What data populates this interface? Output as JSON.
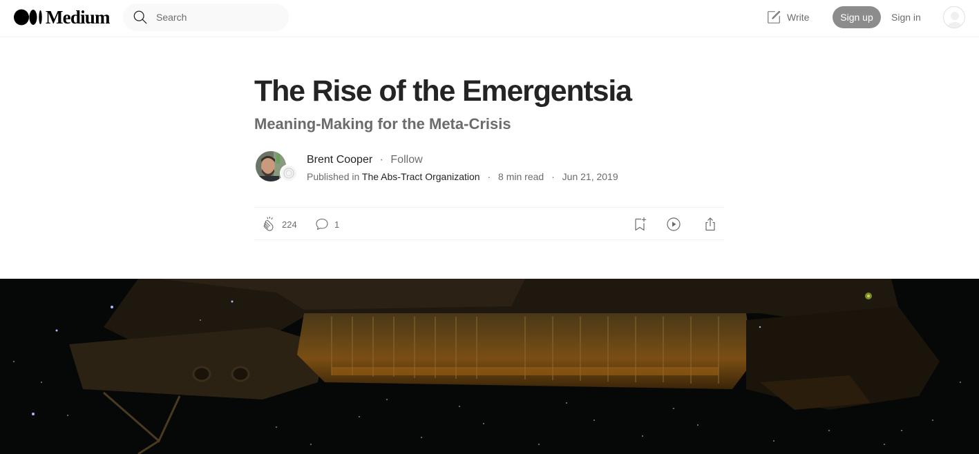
{
  "header": {
    "brand": "Medium",
    "search_placeholder": "Search",
    "write_label": "Write",
    "signup_label": "Sign up",
    "signin_label": "Sign in"
  },
  "article": {
    "title": "The Rise of the Emergentsia",
    "subtitle": "Meaning-Making for the Meta-Crisis",
    "author": "Brent Cooper",
    "follow_label": "Follow",
    "published_in_label": "Published in",
    "publication": "The Abs-Tract Organization",
    "read_time": "8 min read",
    "date": "Jun 21, 2019"
  },
  "actions": {
    "claps": "224",
    "comments": "1"
  },
  "icons": [
    "search-icon",
    "write-icon",
    "clap-icon",
    "comment-icon",
    "bookmark-icon",
    "play-icon",
    "share-icon"
  ],
  "colors": {
    "text": "#242424",
    "muted": "#6b6b6b",
    "signup_bg": "#8c8c8c",
    "search_bg": "#f9f9f9"
  }
}
